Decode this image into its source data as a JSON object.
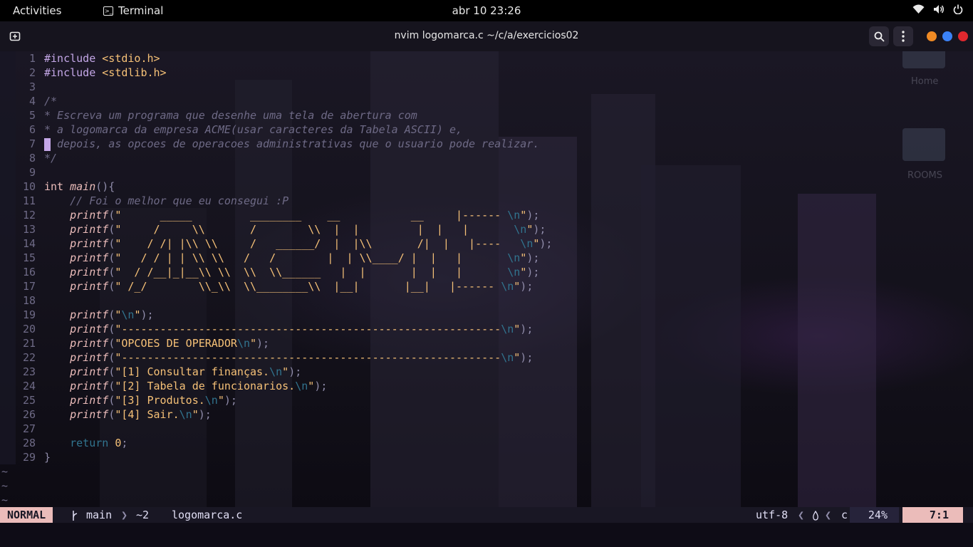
{
  "topbar": {
    "activities": "Activities",
    "app_name": "Terminal",
    "clock": "abr 10  23:26"
  },
  "header": {
    "title": "nvim logomarca.c  ~/c/a/exercicios02"
  },
  "desktop": {
    "home_label": "Home",
    "rooms_label": "ROOMS"
  },
  "editor": {
    "line_numbers": [
      "1",
      "2",
      "3",
      "4",
      "5",
      "6",
      "7",
      "8",
      "9",
      "10",
      "11",
      "12",
      "13",
      "14",
      "15",
      "16",
      "17",
      "18",
      "19",
      "20",
      "21",
      "22",
      "23",
      "24",
      "25",
      "26",
      "27",
      "28",
      "29"
    ],
    "include1_directive": "#include",
    "include1_header": "<stdio.h>",
    "include2_directive": "#include",
    "include2_header": "<stdlib.h>",
    "comment_open": "/*",
    "comment_l5": "* Escreva um programa que desenhe uma tela de abertura com",
    "comment_l6": "* a logomarca da empresa ACME(usar caracteres da Tabela ASCII) e,",
    "comment_l7": " depois, as opcoes de operacoes administrativas que o usuario pode realizar.",
    "comment_close": "*/",
    "main_type": "int",
    "main_name": "main",
    "main_rest": "(){",
    "comment_l11": "// Foi o melhor que eu consegui :P",
    "fn_printf": "printf",
    "ascii_rows": [
      "      _____         ________    __           __     |------ ",
      "     /     \\\\       /        \\\\  |  |         |  |   |       ",
      "    / /| |\\\\ \\\\     /   ______/  |  |\\\\       /|  |   |----   ",
      "   / / | | \\\\ \\\\   /   /        |  | \\\\____/ |  |   |       ",
      "  / /__|_|__\\\\ \\\\  \\\\  \\\\______   |  |       |  |   |       ",
      " /_/        \\\\_\\\\  \\\\________\\\\  |__|       |__|   |------ "
    ],
    "dash_line": "-----------------------------------------------------------",
    "menu_header": "OPCOES DE OPERADOR",
    "menu_items": [
      "[1] Consultar finanças.",
      "[2] Tabela de funcionarios.",
      "[3] Produtos.",
      "[4] Sair."
    ],
    "esc_newline": "\\n",
    "return_kw": "return",
    "return_val": "0",
    "closing_brace": "}",
    "tilde": "~"
  },
  "statusline": {
    "mode": "NORMAL",
    "branch": "main",
    "changes": "~2",
    "filename": "logomarca.c",
    "encoding": "utf-8",
    "filetype": "c",
    "percent": "24%",
    "position": "7:1"
  },
  "colors": {
    "keyword": "#31748f",
    "string": "#f6c177",
    "include": "#c4a7e7",
    "function": "#ebbcba",
    "comment": "#6e6a86",
    "mode_bg": "#ebbcba",
    "dot_orange": "#f08a24",
    "dot_blue": "#3b82f6",
    "dot_red": "#e0282e"
  }
}
